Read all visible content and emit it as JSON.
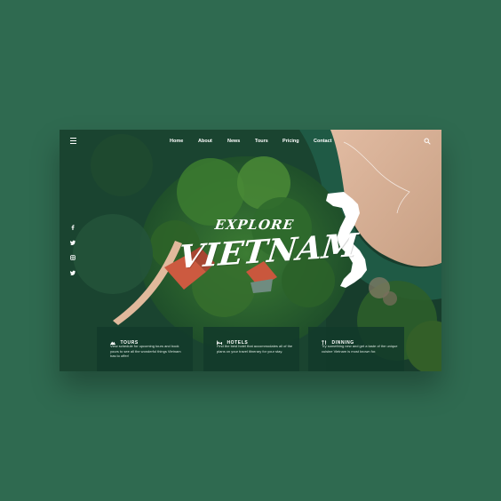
{
  "nav": {
    "menu_icon": "hamburger-icon",
    "links": [
      "Home",
      "About",
      "News",
      "Tours",
      "Pricing",
      "Contact"
    ],
    "search_icon": "search-icon"
  },
  "social": [
    "facebook-icon",
    "twitter-icon",
    "instagram-icon",
    "twitter-icon"
  ],
  "hero": {
    "subtitle": "EXPLORE",
    "title": "VIETNAM"
  },
  "cards": [
    {
      "icon": "mountain-icon",
      "title": "TOURS",
      "text": "View schedule for upcoming tours and book yours to see all the wonderful things Vietnam has to offer!"
    },
    {
      "icon": "bed-icon",
      "title": "HOTELS",
      "text": "Find the best hotel that accommodates all of the plans on your travel itinerary for your stay."
    },
    {
      "icon": "food-icon",
      "title": "DINNING",
      "text": "Try something new and get a taste of the unique cuisine Vietnam is most known for."
    }
  ],
  "colors": {
    "background": "#2f6a50",
    "panel": "#123a2a",
    "sand": "#d9b49a",
    "roof": "#c8513b"
  }
}
